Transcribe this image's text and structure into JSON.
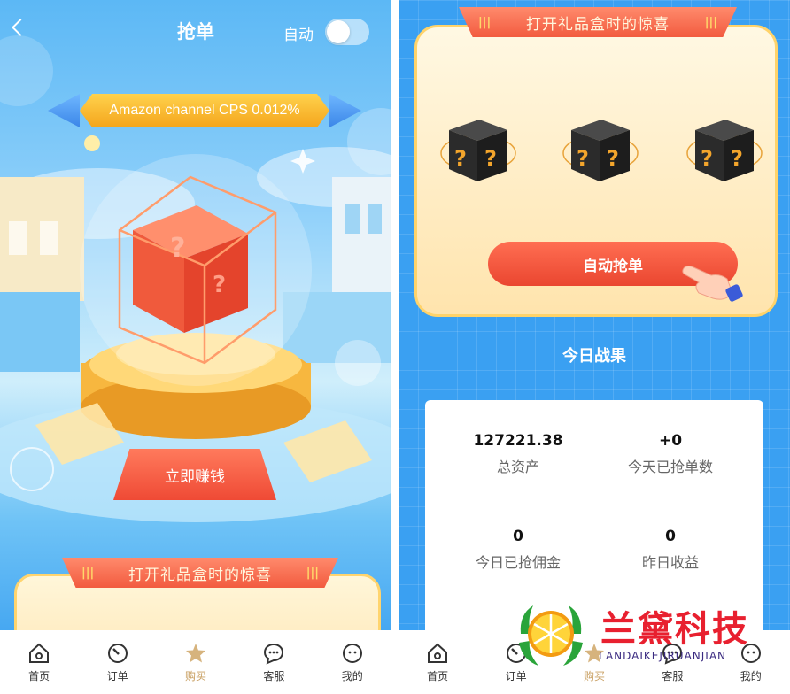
{
  "left_screen": {
    "title": "抢单",
    "auto_label": "自动",
    "auto_toggle_on": false,
    "channel_banner": "Amazon channel CPS 0.012%",
    "earn_button": "立即赚钱",
    "gift_banner": "打开礼品盒时的惊喜"
  },
  "right_screen": {
    "gift_banner": "打开礼品盒时的惊喜",
    "auto_button": "自动抢单",
    "results_title": "今日战果",
    "stats": [
      {
        "value": "127221.38",
        "label": "总资产"
      },
      {
        "value": "+0",
        "label": "今天已抢单数"
      },
      {
        "value": "0",
        "label": "今日已抢佣金"
      },
      {
        "value": "0",
        "label": "昨日收益"
      }
    ]
  },
  "nav": {
    "items": [
      {
        "label": "首页",
        "icon": "home-icon"
      },
      {
        "label": "订单",
        "icon": "gauge-icon"
      },
      {
        "label": "购买",
        "icon": "star-icon"
      },
      {
        "label": "客服",
        "icon": "chat-icon"
      },
      {
        "label": "我的",
        "icon": "face-icon"
      }
    ],
    "active_index": 2
  },
  "watermark": {
    "title": "兰黛科技",
    "subtitle": "LANDAIKEJIRUANJIAN"
  },
  "colors": {
    "primary_red": "#ef4a35",
    "gold": "#f4a51c",
    "sky_blue": "#3aa0f2",
    "nav_active": "#c9a063"
  }
}
